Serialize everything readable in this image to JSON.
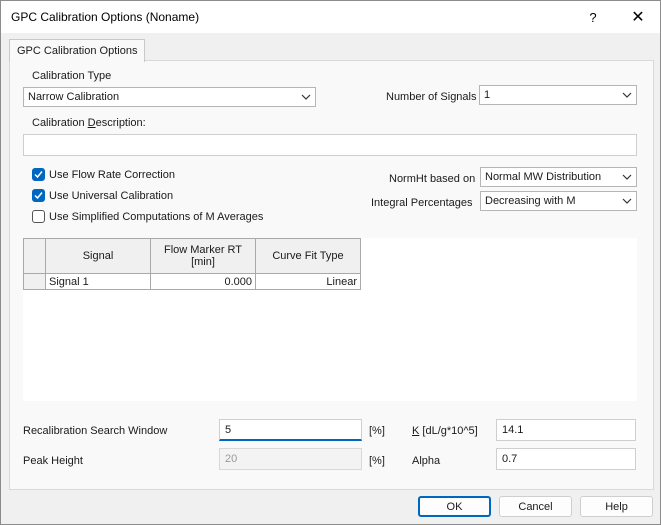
{
  "window": {
    "title": "GPC Calibration Options (Noname)",
    "help_glyph": "?",
    "close_glyph": "✕"
  },
  "tab": {
    "label": "GPC Calibration Options"
  },
  "calibration_type": {
    "label": "Calibration Type",
    "value": "Narrow Calibration"
  },
  "number_of_signals": {
    "label": "Number of Signals",
    "value": "1"
  },
  "calibration_description": {
    "label_pre": "Calibration ",
    "label_accel": "D",
    "label_post": "escription:",
    "value": ""
  },
  "checkboxes": [
    {
      "label": "Use Flow Rate Correction",
      "checked": true
    },
    {
      "label": "Use Universal Calibration",
      "checked": true
    },
    {
      "label": "Use Simplified Computations of M Averages",
      "checked": false
    }
  ],
  "normht": {
    "label": "NormHt based on",
    "value": "Normal MW Distribution"
  },
  "integral_percentages": {
    "label": "Integral Percentages",
    "value": "Decreasing with M"
  },
  "grid": {
    "headers": [
      "",
      "Signal",
      "Flow Marker RT\n[min]",
      "Curve Fit Type"
    ],
    "rows": [
      {
        "marker": "",
        "signal": "Signal 1",
        "flow_marker_rt": "0.000",
        "curve_fit": "Linear"
      }
    ]
  },
  "recalibration": {
    "label": "Recalibration Search Window",
    "value": "5",
    "unit": "[%]"
  },
  "peak_height": {
    "label": "Peak Height",
    "value": "20",
    "unit": "[%]"
  },
  "k": {
    "label_accel": "K",
    "label_post": " [dL/g*10^5]",
    "value": "14.1"
  },
  "alpha": {
    "label": "Alpha",
    "value": "0.7"
  },
  "buttons": {
    "ok": "OK",
    "cancel": "Cancel",
    "help": "Help"
  },
  "colors": {
    "accent": "#0067c0"
  }
}
